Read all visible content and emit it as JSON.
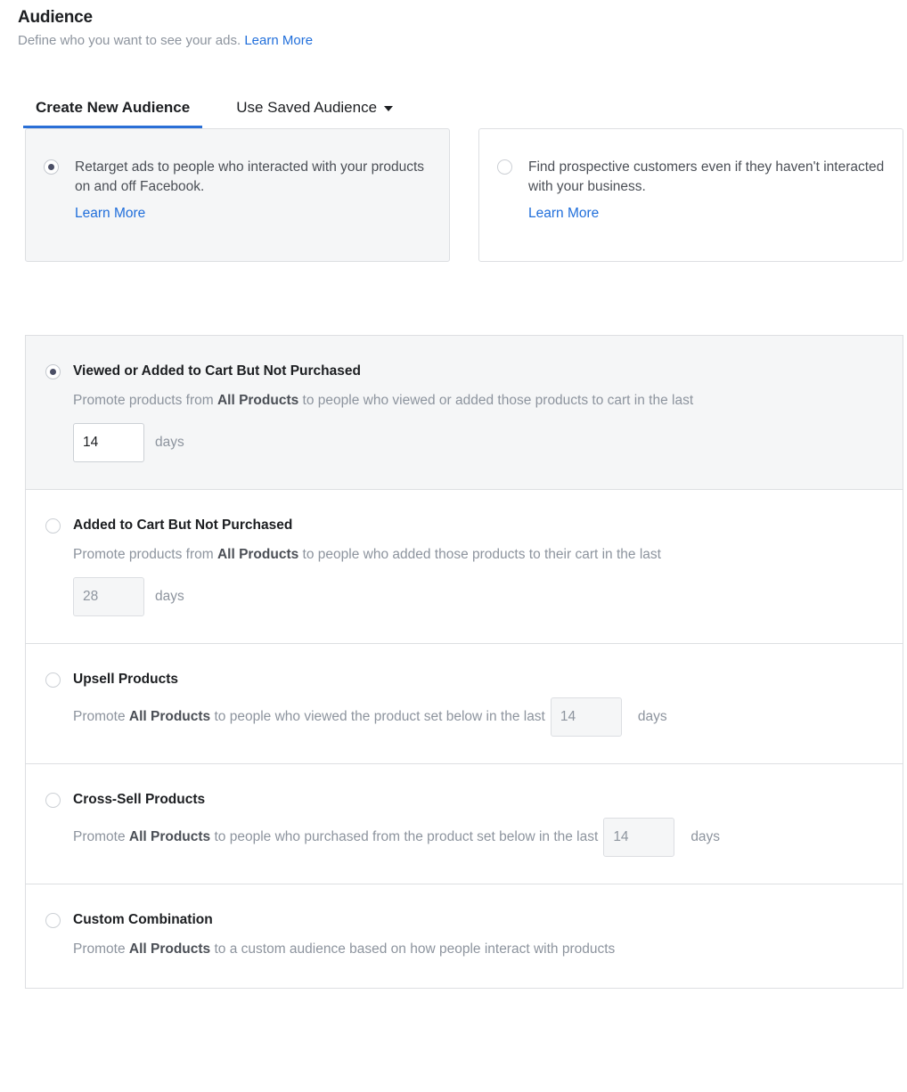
{
  "header": {
    "title": "Audience",
    "subtitle": "Define who you want to see your ads.",
    "learn_more": "Learn More"
  },
  "tabs": [
    {
      "label": "Create New Audience",
      "active": true
    },
    {
      "label": "Use Saved Audience",
      "active": false,
      "has_caret": true
    }
  ],
  "cards": [
    {
      "text": "Retarget ads to people who interacted with your products on and off Facebook.",
      "link": "Learn More",
      "selected": true
    },
    {
      "text": "Find prospective customers even if they haven't interacted with your business.",
      "link": "Learn More",
      "selected": false
    }
  ],
  "options": [
    {
      "title": "Viewed or Added to Cart But Not Purchased",
      "desc_pre": "Promote products from ",
      "product_set": "All Products",
      "desc_post": " to people who viewed or added those products to cart in the last",
      "days_value": "14",
      "days_label": "days",
      "input_disabled": false,
      "inline_input": false,
      "selected": true
    },
    {
      "title": "Added to Cart But Not Purchased",
      "desc_pre": "Promote products from ",
      "product_set": "All Products",
      "desc_post": " to people who added those products to their cart in the last",
      "days_value": "28",
      "days_label": "days",
      "input_disabled": true,
      "inline_input": false,
      "selected": false
    },
    {
      "title": "Upsell Products",
      "desc_pre": "Promote ",
      "product_set": "All Products",
      "desc_post": " to people who viewed the product set below in the last",
      "days_value": "14",
      "days_label": "days",
      "input_disabled": true,
      "inline_input": true,
      "selected": false
    },
    {
      "title": "Cross-Sell Products",
      "desc_pre": "Promote ",
      "product_set": "All Products",
      "desc_post": " to people who purchased from the product set below in the last",
      "days_value": "14",
      "days_label": "days",
      "input_disabled": true,
      "inline_input": true,
      "selected": false
    },
    {
      "title": "Custom Combination",
      "desc_pre": "Promote ",
      "product_set": "All Products",
      "desc_post": " to a custom audience based on how people interact with products",
      "days_value": "",
      "days_label": "",
      "input_disabled": true,
      "inline_input": false,
      "has_input": false,
      "selected": false
    }
  ],
  "colors": {
    "accent_blue": "#216fdb",
    "tab_underline": "#2a6fd6",
    "selected_row_bg": "#f5f6f7",
    "border": "#dddfe2",
    "muted_text": "#8d949e"
  }
}
